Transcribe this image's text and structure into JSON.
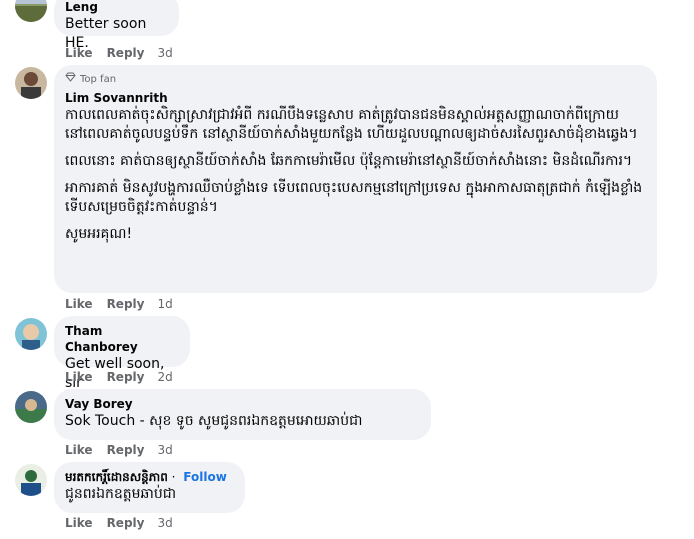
{
  "comments": [
    {
      "author": "Leng",
      "text": "Better soon HE.",
      "like": "Like",
      "reply": "Reply",
      "time": "3d"
    },
    {
      "badge": "Top fan",
      "author": "Lim Sovannrith",
      "p1": "កាលពេលគាត់ចុះសិក្សាស្រាវជ្រាវអំពី ករណីបឹងទន្លេសាប គាត់ត្រូវបានជនមិនស្គាល់អត្តសញ្ញាណចាក់ពីក្រោយ នៅពេលគាត់ចូលបន្ទប់ទឹក នៅស្ថានីយ៍ចាក់សាំងមួយកន្លែង ហើយដួលបណ្ដាលឲ្យដាច់សរសៃពួរសាច់ដុំខាងឆ្វេង។",
      "p2": "ពេលនោះ គាត់បានឲ្យស្ថានីយ៍ចាក់សាំង ឆែកកាមេរ៉ាមើល ប៉ុន្តែកាមេរ៉ានៅស្ថានីយ៍ចាក់សាំងនោះ មិនដំណើរការ។",
      "p3": "អាការគាត់ មិនសូវបង្ហការឈឺចាប់ខ្លាំងទេ ទើបពេលចុះបេសកម្មនៅក្រៅប្រទេស ក្នុងអាកាសធាតុត្រជាក់ កំឡើងខ្លាំង ទើបសម្រេចចិត្តវះកាត់បន្ទាន់។",
      "p4": "សូមអរគុណ!",
      "like": "Like",
      "reply": "Reply",
      "time": "1d"
    },
    {
      "author": "Tham Chanborey",
      "text": "Get well soon, sir",
      "like": "Like",
      "reply": "Reply",
      "time": "2d"
    },
    {
      "author": "Vay Borey",
      "text": "Sok Touch - សុខ ទូច សូមជូនពរឯកឧត្តមអោយឆាប់ជា",
      "like": "Like",
      "reply": "Reply",
      "time": "3d"
    },
    {
      "author": "មរតកកេរ្តិ៍ដោនសន្តិភាព",
      "follow": "Follow",
      "text": "ជូនពរឯកឧត្តមឆាប់ជា",
      "like": "Like",
      "reply": "Reply",
      "time": "3d"
    }
  ],
  "icons": {
    "badge": "diamond-icon"
  }
}
